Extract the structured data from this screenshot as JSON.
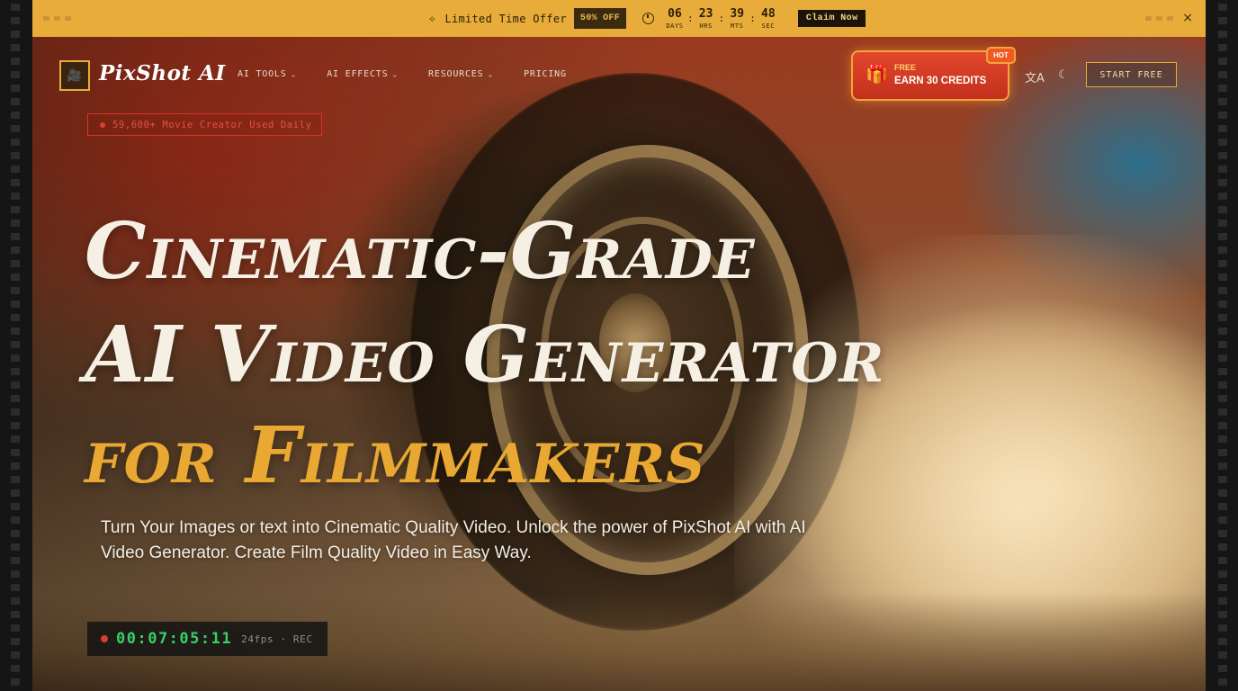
{
  "promo": {
    "offer_label": "Limited Time Offer",
    "discount": "50% OFF",
    "countdown": [
      {
        "value": "06",
        "unit": "DAYS"
      },
      {
        "value": "23",
        "unit": "HRS"
      },
      {
        "value": "39",
        "unit": "MTS"
      },
      {
        "value": "48",
        "unit": "SEC"
      }
    ],
    "claim_label": "Claim Now",
    "close": "×"
  },
  "brand": {
    "name": "PixShot AI",
    "accent": "#e8ac3a"
  },
  "nav": {
    "items": [
      "AI TOOLS",
      "AI EFFECTS",
      "RESOURCES",
      "PRICING"
    ]
  },
  "credits": {
    "free": "FREE",
    "label": "EARN 30 CREDITS",
    "hot": "HOT"
  },
  "actions": {
    "start": "START FREE",
    "translate_icon": "translate-icon",
    "theme_icon": "moon-icon"
  },
  "hero": {
    "users_badge": "59,600+ Movie Creator Used Daily",
    "title_line1": "Cinematic-Grade",
    "title_line2": "AI Video Generator",
    "title_line3": "for Filmmakers",
    "subtitle": "Turn Your Images or text into Cinematic Quality Video. Unlock the power of PixShot AI with AI Video Generator. Create Film Quality Video in Easy Way."
  },
  "recorder": {
    "timecode": "00:07:05:11",
    "info": "24fps · REC"
  }
}
